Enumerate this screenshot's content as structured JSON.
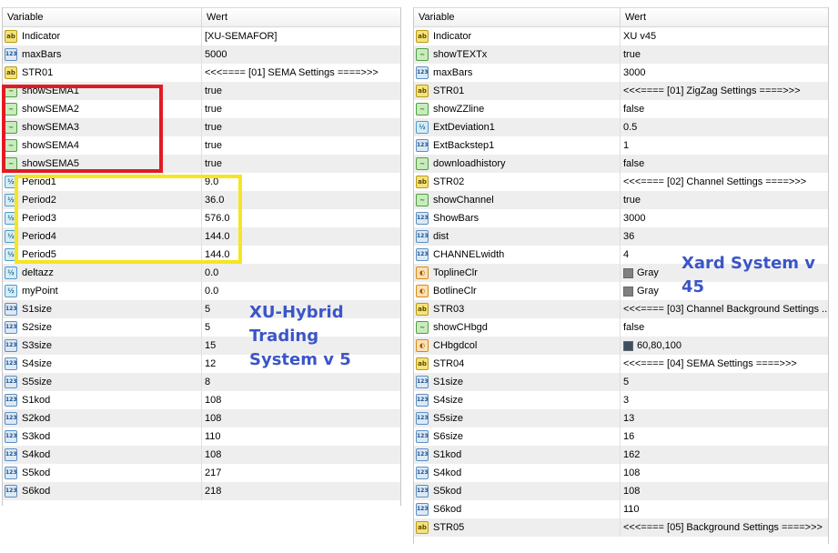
{
  "left_panel": {
    "headers": [
      "Variable",
      "Wert"
    ],
    "rows": [
      {
        "type": "string",
        "icon": "ab",
        "name": "Indicator",
        "value": "[XU-SEMAFOR]"
      },
      {
        "type": "int",
        "icon": "123",
        "name": "maxBars",
        "value": "5000"
      },
      {
        "type": "string",
        "icon": "ab",
        "name": "STR01",
        "value": "<<<==== [01] SEMA Settings ====>>>"
      },
      {
        "type": "bool",
        "icon": "~",
        "name": "showSEMA1",
        "value": "true"
      },
      {
        "type": "bool",
        "icon": "~",
        "name": "showSEMA2",
        "value": "true"
      },
      {
        "type": "bool",
        "icon": "~",
        "name": "showSEMA3",
        "value": "true"
      },
      {
        "type": "bool",
        "icon": "~",
        "name": "showSEMA4",
        "value": "true"
      },
      {
        "type": "bool",
        "icon": "~",
        "name": "showSEMA5",
        "value": "true"
      },
      {
        "type": "double",
        "icon": "½",
        "name": "Period1",
        "value": "9.0"
      },
      {
        "type": "double",
        "icon": "½",
        "name": "Period2",
        "value": "36.0"
      },
      {
        "type": "double",
        "icon": "½",
        "name": "Period3",
        "value": "576.0"
      },
      {
        "type": "double",
        "icon": "½",
        "name": "Period4",
        "value": "144.0"
      },
      {
        "type": "double",
        "icon": "½",
        "name": "Period5",
        "value": "144.0"
      },
      {
        "type": "double",
        "icon": "½",
        "name": "deltazz",
        "value": "0.0"
      },
      {
        "type": "double",
        "icon": "½",
        "name": "myPoint",
        "value": "0.0"
      },
      {
        "type": "int",
        "icon": "123",
        "name": "S1size",
        "value": "5"
      },
      {
        "type": "int",
        "icon": "123",
        "name": "S2size",
        "value": "5"
      },
      {
        "type": "int",
        "icon": "123",
        "name": "S3size",
        "value": "15"
      },
      {
        "type": "int",
        "icon": "123",
        "name": "S4size",
        "value": "12"
      },
      {
        "type": "int",
        "icon": "123",
        "name": "S5size",
        "value": "8"
      },
      {
        "type": "int",
        "icon": "123",
        "name": "S1kod",
        "value": "108"
      },
      {
        "type": "int",
        "icon": "123",
        "name": "S2kod",
        "value": "108"
      },
      {
        "type": "int",
        "icon": "123",
        "name": "S3kod",
        "value": "110"
      },
      {
        "type": "int",
        "icon": "123",
        "name": "S4kod",
        "value": "108"
      },
      {
        "type": "int",
        "icon": "123",
        "name": "S5kod",
        "value": "217"
      },
      {
        "type": "int",
        "icon": "123",
        "name": "S6kod",
        "value": "218"
      }
    ],
    "label_lines": [
      "XU-Hybrid",
      "Trading",
      "System v 5"
    ]
  },
  "right_panel": {
    "headers": [
      "Variable",
      "Wert"
    ],
    "rows": [
      {
        "type": "string",
        "icon": "ab",
        "name": "Indicator",
        "value": "XU v45"
      },
      {
        "type": "bool",
        "icon": "~",
        "name": "showTEXTx",
        "value": "true"
      },
      {
        "type": "int",
        "icon": "123",
        "name": "maxBars",
        "value": "3000"
      },
      {
        "type": "string",
        "icon": "ab",
        "name": "STR01",
        "value": "<<<==== [01] ZigZag Settings ====>>>"
      },
      {
        "type": "bool",
        "icon": "~",
        "name": "showZZline",
        "value": "false"
      },
      {
        "type": "double",
        "icon": "½",
        "name": "ExtDeviation1",
        "value": "0.5"
      },
      {
        "type": "int",
        "icon": "123",
        "name": "ExtBackstep1",
        "value": "1"
      },
      {
        "type": "bool",
        "icon": "~",
        "name": "downloadhistory",
        "value": "false"
      },
      {
        "type": "string",
        "icon": "ab",
        "name": "STR02",
        "value": "<<<==== [02] Channel Settings ====>>>"
      },
      {
        "type": "bool",
        "icon": "~",
        "name": "showChannel",
        "value": "true"
      },
      {
        "type": "int",
        "icon": "123",
        "name": "ShowBars",
        "value": "3000"
      },
      {
        "type": "int",
        "icon": "123",
        "name": "dist",
        "value": "36"
      },
      {
        "type": "int",
        "icon": "123",
        "name": "CHANNELwidth",
        "value": "4"
      },
      {
        "type": "color",
        "icon": "◐",
        "name": "ToplineClr",
        "value": "Gray",
        "swatch": "#808080"
      },
      {
        "type": "color",
        "icon": "◐",
        "name": "BotlineClr",
        "value": "Gray",
        "swatch": "#808080"
      },
      {
        "type": "string",
        "icon": "ab",
        "name": "STR03",
        "value": "<<<==== [03] Channel Background Settings ..."
      },
      {
        "type": "bool",
        "icon": "~",
        "name": "showCHbgd",
        "value": "false"
      },
      {
        "type": "color",
        "icon": "◐",
        "name": "CHbgdcol",
        "value": "60,80,100",
        "swatch": "#3c5064"
      },
      {
        "type": "string",
        "icon": "ab",
        "name": "STR04",
        "value": "<<<==== [04] SEMA Settings ====>>>"
      },
      {
        "type": "int",
        "icon": "123",
        "name": "S1size",
        "value": "5"
      },
      {
        "type": "int",
        "icon": "123",
        "name": "S4size",
        "value": "3"
      },
      {
        "type": "int",
        "icon": "123",
        "name": "S5size",
        "value": "13"
      },
      {
        "type": "int",
        "icon": "123",
        "name": "S6size",
        "value": "16"
      },
      {
        "type": "int",
        "icon": "123",
        "name": "S1kod",
        "value": "162"
      },
      {
        "type": "int",
        "icon": "123",
        "name": "S4kod",
        "value": "108"
      },
      {
        "type": "int",
        "icon": "123",
        "name": "S5kod",
        "value": "108"
      },
      {
        "type": "int",
        "icon": "123",
        "name": "S6kod",
        "value": "110"
      },
      {
        "type": "string",
        "icon": "ab",
        "name": "STR05",
        "value": "<<<==== [05] Background Settings ====>>>"
      }
    ],
    "label": "Xard System v 45"
  },
  "colors": {
    "highlight_red": "#e01b24",
    "highlight_yellow": "#f7e51f",
    "label_blue": "#3b55c8"
  }
}
